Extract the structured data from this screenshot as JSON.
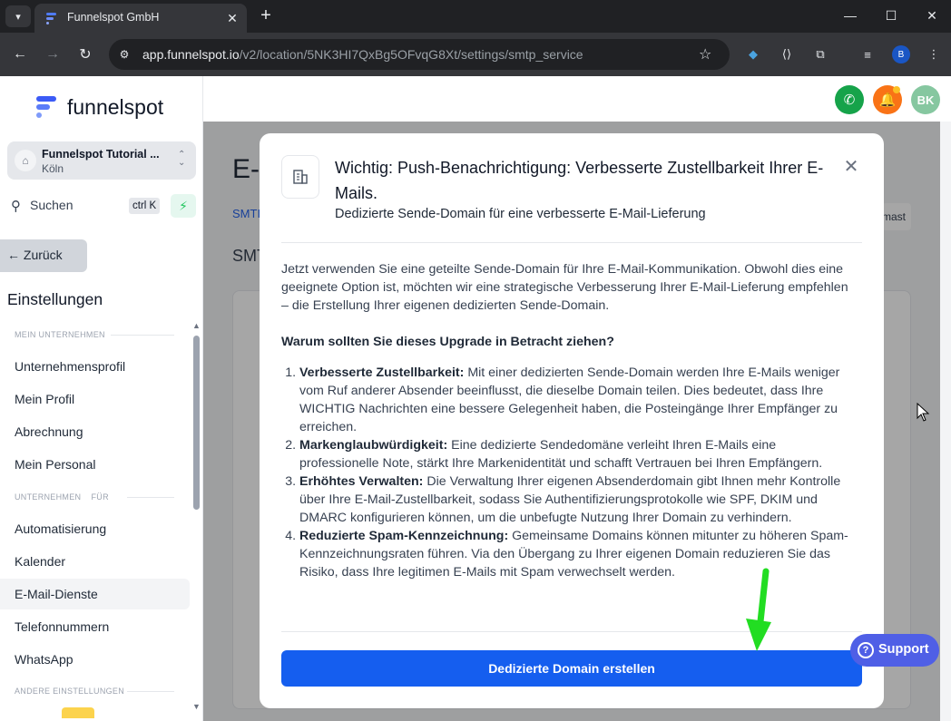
{
  "browser": {
    "tab_title": "Funnelspot GmbH",
    "url_host": "app.funnelspot.io",
    "url_path": "/v2/location/5NK3HI7QxBg5OFvqG8Xt/settings/smtp_service",
    "profile_initial": "B"
  },
  "sidebar": {
    "logo_text": "funnelspot",
    "account_name": "Funnelspot Tutorial ...",
    "account_city": "Köln",
    "search_label": "Suchen",
    "search_shortcut": "ctrl K",
    "back_label": "Zurück",
    "settings_title": "Einstellungen",
    "sections": {
      "company": "MEIN UNTERNEHMEN",
      "business": "UNTERNEHMEN    FÜR",
      "other": "ANDERE EINSTELLUNGEN"
    },
    "items": [
      "Unternehmensprofil",
      "Mein Profil",
      "Abrechnung",
      "Mein Personal",
      "Automatisierung",
      "Kalender",
      "E-Mail-Dienste",
      "Telefonnummern",
      "WhatsApp"
    ]
  },
  "topbar": {
    "avatar_initials": "BK"
  },
  "background": {
    "title": "E-",
    "tab": "SMTI",
    "subtitle": "SMT",
    "right_tab": "mast"
  },
  "modal": {
    "title": "Wichtig: Push-Benachrichtigung: Verbesserte Zustellbarkeit Ihrer E-Mails.",
    "subtitle": "Dedizierte Sende-Domain für eine verbesserte E-Mail-Lieferung",
    "intro": "Jetzt verwenden Sie eine geteilte Sende-Domain für Ihre E-Mail-Kommunikation. Obwohl dies eine geeignete Option ist, möchten wir eine strategische Verbesserung Ihrer E-Mail-Lieferung empfehlen – die Erstellung Ihrer eigenen dedizierten Sende-Domain.",
    "question": "Warum sollten Sie dieses Upgrade in Betracht ziehen?",
    "points": [
      {
        "title": "Verbesserte Zustellbarkeit:",
        "text": " Mit einer dedizierten Sende-Domain werden Ihre E-Mails weniger vom Ruf anderer Absender beeinflusst, die dieselbe Domain teilen. Dies bedeutet, dass Ihre WICHTIG Nachrichten eine bessere Gelegenheit haben, die Posteingänge Ihrer Empfänger zu erreichen."
      },
      {
        "title": "Markenglaubwürdigkeit:",
        "text": " Eine dedizierte Sendedomäne verleiht Ihren E-Mails eine professionelle Note, stärkt Ihre Markenidentität und schafft Vertrauen bei Ihren Empfängern."
      },
      {
        "title": "Erhöhtes Verwalten:",
        "text": " Die Verwaltung Ihrer eigenen Absenderdomain gibt Ihnen mehr Kontrolle über Ihre E-Mail-Zustellbarkeit, sodass Sie Authentifizierungsprotokolle wie SPF, DKIM und DMARC konfigurieren können, um die unbefugte Nutzung Ihrer Domain zu verhindern."
      },
      {
        "title": "Reduzierte Spam-Kennzeichnung:",
        "text": " Gemeinsame Domains können mitunter zu höheren Spam-Kennzeichnungsraten führen. Via den Übergang zu Ihrer eigenen Domain reduzieren Sie das Risiko, dass Ihre legitimen E-Mails mit Spam verwechselt werden."
      }
    ],
    "button_label": "Dedizierte Domain erstellen"
  },
  "support": {
    "label": "Support"
  },
  "colors": {
    "primary": "#155eef",
    "support": "#4f5fe6",
    "arrow": "#22dd22"
  }
}
